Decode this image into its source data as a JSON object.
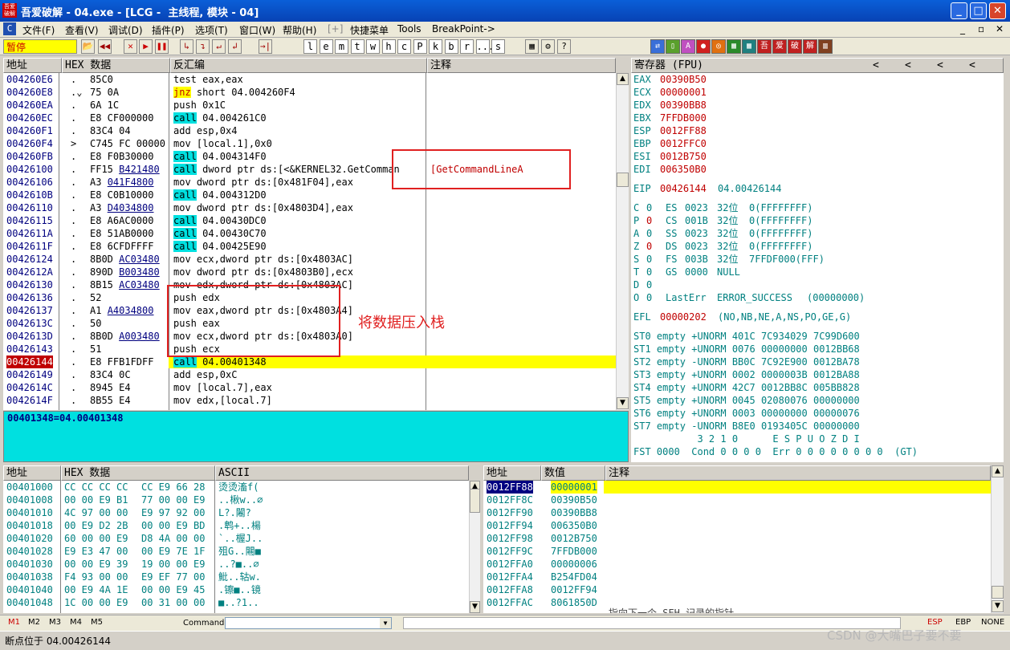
{
  "title": {
    "icon_text": "吾爱破解",
    "text": "吾爱破解 - 04.exe - [LCG -  主线程, 模块 - 04]",
    "min": "_",
    "max": "□",
    "close": "✕"
  },
  "menu": {
    "icon": "C",
    "items": [
      "文件(F)",
      "查看(V)",
      "调试(D)",
      "插件(P)",
      "选项(T)",
      "窗口(W)",
      "帮助(H)",
      "[+]",
      "快捷菜单",
      "Tools",
      "BreakPoint->"
    ],
    "child_btns": [
      "_",
      "▫",
      "✕"
    ]
  },
  "toolbar": {
    "state": "暂停",
    "buttons": [
      "📂",
      "◀◀",
      "✕",
      "▶",
      "❚❚",
      "↳",
      "↴",
      "↵",
      "↲",
      "→|"
    ],
    "letters": [
      "l",
      "e",
      "m",
      "t",
      "w",
      "h",
      "c",
      "P",
      "k",
      "b",
      "r",
      "...",
      "s"
    ],
    "icons": [
      "▦",
      "⚙",
      "?"
    ],
    "right_icons": [
      "⇄",
      "▯",
      "A",
      "●",
      "◎",
      "▦",
      "▦",
      "吾",
      "爱",
      "破",
      "解",
      "▥"
    ],
    "right_colors": [
      "#3a6fd8",
      "#5aa02c",
      "#c050c0",
      "#d02020",
      "#e07010",
      "#2a8a2a",
      "#208080",
      "#c02020",
      "#c02020",
      "#c02020",
      "#c02020",
      "#804020"
    ]
  },
  "disasm": {
    "headers": {
      "addr": "地址",
      "hex": "HEX 数据",
      "asm": "反汇编",
      "comment": "注释"
    },
    "rows": [
      {
        "addr": "004260E6",
        "mark": ".",
        "hex": "85C0",
        "hexu": "",
        "asm": "test eax,eax",
        "kw": "",
        "cmt": ""
      },
      {
        "addr": "004260E8",
        "mark": ".⌄",
        "hex": "75 0A",
        "hexu": "",
        "asm": "jnz short 04.004260F4",
        "kw": "jnz",
        "cmt": ""
      },
      {
        "addr": "004260EA",
        "mark": ".",
        "hex": "6A 1C",
        "hexu": "",
        "asm": "push 0x1C",
        "kw": "",
        "cmt": ""
      },
      {
        "addr": "004260EC",
        "mark": ".",
        "hex": "E8 CF000000",
        "hexu": "",
        "asm": "call 04.004261C0",
        "kw": "call",
        "cmt": ""
      },
      {
        "addr": "004260F1",
        "mark": ".",
        "hex": "83C4 04",
        "hexu": "",
        "asm": "add esp,0x4",
        "kw": "",
        "cmt": ""
      },
      {
        "addr": "004260F4",
        "mark": ">",
        "hex": "C745 FC 00000",
        "hexu": "",
        "asm": "mov [local.1],0x0",
        "kw": "",
        "cmt": ""
      },
      {
        "addr": "004260FB",
        "mark": ".",
        "hex": "E8 F0B30000",
        "hexu": "",
        "asm": "call 04.004314F0",
        "kw": "call",
        "cmt": ""
      },
      {
        "addr": "00426100",
        "mark": ".",
        "hex": "FF15 ",
        "hexu": "B421480",
        "asm": "call dword ptr ds:[<&KERNEL32.GetComman",
        "kw": "call",
        "cmt": "[GetCommandLineA"
      },
      {
        "addr": "00426106",
        "mark": ".",
        "hex": "A3 ",
        "hexu": "041F4800",
        "asm": "mov dword ptr ds:[0x481F04],eax",
        "kw": "",
        "cmt": ""
      },
      {
        "addr": "0042610B",
        "mark": ".",
        "hex": "E8 C0B10000",
        "hexu": "",
        "asm": "call 04.004312D0",
        "kw": "call",
        "cmt": ""
      },
      {
        "addr": "00426110",
        "mark": ".",
        "hex": "A3 ",
        "hexu": "D4034800",
        "asm": "mov dword ptr ds:[0x4803D4],eax",
        "kw": "",
        "cmt": ""
      },
      {
        "addr": "00426115",
        "mark": ".",
        "hex": "E8 A6AC0000",
        "hexu": "",
        "asm": "call 04.00430DC0",
        "kw": "call",
        "cmt": ""
      },
      {
        "addr": "0042611A",
        "mark": ".",
        "hex": "E8 51AB0000",
        "hexu": "",
        "asm": "call 04.00430C70",
        "kw": "call",
        "cmt": ""
      },
      {
        "addr": "0042611F",
        "mark": ".",
        "hex": "E8 6CFDFFFF",
        "hexu": "",
        "asm": "call 04.00425E90",
        "kw": "call",
        "cmt": ""
      },
      {
        "addr": "00426124",
        "mark": ".",
        "hex": "8B0D ",
        "hexu": "AC03480",
        "asm": "mov ecx,dword ptr ds:[0x4803AC]",
        "kw": "",
        "cmt": ""
      },
      {
        "addr": "0042612A",
        "mark": ".",
        "hex": "890D ",
        "hexu": "B003480",
        "asm": "mov dword ptr ds:[0x4803B0],ecx",
        "kw": "",
        "cmt": ""
      },
      {
        "addr": "00426130",
        "mark": ".",
        "hex": "8B15 ",
        "hexu": "AC03480",
        "asm": "mov edx,dword ptr ds:[0x4803AC]",
        "kw": "",
        "cmt": ""
      },
      {
        "addr": "00426136",
        "mark": ".",
        "hex": "52",
        "hexu": "",
        "asm": "push edx",
        "kw": "",
        "cmt": ""
      },
      {
        "addr": "00426137",
        "mark": ".",
        "hex": "A1 ",
        "hexu": "A4034800",
        "asm": "mov eax,dword ptr ds:[0x4803A4]",
        "kw": "",
        "cmt": ""
      },
      {
        "addr": "0042613C",
        "mark": ".",
        "hex": "50",
        "hexu": "",
        "asm": "push eax",
        "kw": "",
        "cmt": ""
      },
      {
        "addr": "0042613D",
        "mark": ".",
        "hex": "8B0D ",
        "hexu": "A003480",
        "asm": "mov ecx,dword ptr ds:[0x4803A0]",
        "kw": "",
        "cmt": ""
      },
      {
        "addr": "00426143",
        "mark": ".",
        "hex": "51",
        "hexu": "",
        "asm": "push ecx",
        "kw": "",
        "cmt": ""
      },
      {
        "addr": "00426144",
        "mark": ".",
        "hex": "E8 FFB1FDFF",
        "hexu": "",
        "asm": "call 04.00401348",
        "kw": "call",
        "cmt": "",
        "current": true
      },
      {
        "addr": "00426149",
        "mark": ".",
        "hex": "83C4 0C",
        "hexu": "",
        "asm": "add esp,0xC",
        "kw": "",
        "cmt": ""
      },
      {
        "addr": "0042614C",
        "mark": ".",
        "hex": "8945 E4",
        "hexu": "",
        "asm": "mov [local.7],eax",
        "kw": "",
        "cmt": ""
      },
      {
        "addr": "0042614F",
        "mark": ".",
        "hex": "8B55 E4",
        "hexu": "",
        "asm": "mov edx,[local.7]",
        "kw": "",
        "cmt": ""
      }
    ],
    "info": "00401348=04.00401348",
    "annotation": "将数据压入栈"
  },
  "registers": {
    "header": "寄存器 (FPU)",
    "arrows": [
      "<",
      "<",
      "<",
      "<"
    ],
    "gp": [
      [
        "EAX",
        "00390B50"
      ],
      [
        "ECX",
        "00000001"
      ],
      [
        "EDX",
        "00390BB8"
      ],
      [
        "EBX",
        "7FFDB000"
      ],
      [
        "ESP",
        "0012FF88"
      ],
      [
        "EBP",
        "0012FFC0"
      ],
      [
        "ESI",
        "0012B750"
      ],
      [
        "EDI",
        "006350B0"
      ]
    ],
    "eip": {
      "name": "EIP",
      "value": "00426144",
      "label": "04.00426144"
    },
    "flags": [
      [
        "C",
        "0",
        "ES",
        "0023",
        "32位",
        "0(FFFFFFFF)"
      ],
      [
        "P",
        "0",
        "CS",
        "001B",
        "32位",
        "0(FFFFFFFF)"
      ],
      [
        "A",
        "0",
        "SS",
        "0023",
        "32位",
        "0(FFFFFFFF)"
      ],
      [
        "Z",
        "0",
        "DS",
        "0023",
        "32位",
        "0(FFFFFFFF)"
      ],
      [
        "S",
        "0",
        "FS",
        "003B",
        "32位",
        "7FFDF000(FFF)"
      ],
      [
        "T",
        "0",
        "GS",
        "0000",
        "NULL",
        ""
      ],
      [
        "D",
        "0",
        "",
        "",
        "",
        ""
      ],
      [
        "O",
        "0",
        "LastErr",
        "ERROR_SUCCESS",
        "(00000000)",
        ""
      ]
    ],
    "efl": {
      "name": "EFL",
      "value": "00000202",
      "desc": "(NO,NB,NE,A,NS,PO,GE,G)"
    },
    "fpu": [
      "ST0 empty +UNORM 401C 7C934029 7C99D600",
      "ST1 empty +UNORM 0076 00000000 0012BB68",
      "ST2 empty -UNORM BB0C 7C92E900 0012BA78",
      "ST3 empty +UNORM 0002 0000003B 0012BA88",
      "ST4 empty +UNORM 42C7 0012BB8C 005BB828",
      "ST5 empty +UNORM 0045 02080076 00000000",
      "ST6 empty +UNORM 0003 00000000 00000076",
      "ST7 empty -UNORM B8E0 0193405C 00000000"
    ],
    "fpu_bits": "           3 2 1 0      E S P U O Z D I",
    "fst": "FST 0000  Cond 0 0 0 0  Err 0 0 0 0 0 0 0 0  (GT)"
  },
  "dump": {
    "headers": {
      "addr": "地址",
      "hex": "HEX 数据",
      "ascii": "ASCII"
    },
    "rows": [
      [
        "00401000",
        "CC CC CC CC",
        "CC E9 66 28",
        "烫烫滀f("
      ],
      [
        "00401008",
        "00 00 E9 B1",
        "77 00 00 E9",
        "..楸w..∅"
      ],
      [
        "00401010",
        "4C 97 00 00",
        "E9 97 92 00",
        "L?.闂?"
      ],
      [
        "00401018",
        "00 E9 D2 2B",
        "00 00 E9 BD",
        ".鹎+..楊"
      ],
      [
        "00401020",
        "60 00 00 E9",
        "D8 4A 00 00",
        "`..楃J.."
      ],
      [
        "00401028",
        "E9 E3 47 00",
        "00 E9 7E 1F",
        "殂G..闀■"
      ],
      [
        "00401030",
        "00 00 E9 39",
        "19 00 00 E9",
        "..?■..∅"
      ],
      [
        "00401038",
        "F4 93 00 00",
        "E9 EF 77 00",
        "魮..轱w."
      ],
      [
        "00401040",
        "00 E9 4A 1E",
        "00 00 E9 45",
        ".镲■..镜"
      ],
      [
        "00401048",
        "1C 00 00 E9",
        "00 31 00 00",
        "■..?1.."
      ]
    ]
  },
  "stack": {
    "headers": {
      "addr": "地址",
      "value": "数值",
      "comment": "注释"
    },
    "rows": [
      [
        "0012FF88",
        "00000001"
      ],
      [
        "0012FF8C",
        "00390B50"
      ],
      [
        "0012FF90",
        "00390BB8"
      ],
      [
        "0012FF94",
        "006350B0"
      ],
      [
        "0012FF98",
        "0012B750"
      ],
      [
        "0012FF9C",
        "7FFDB000"
      ],
      [
        "0012FFA0",
        "00000006"
      ],
      [
        "0012FFA4",
        "B254FD04"
      ],
      [
        "0012FFA8",
        "0012FF94"
      ],
      [
        "0012FFAC",
        "8061850D"
      ]
    ],
    "partial_comment": "指向下一个 SEH 记录的指针"
  },
  "command": {
    "tabs": [
      "M1",
      "M2",
      "M3",
      "M4",
      "M5"
    ],
    "label": "Command:",
    "regs": [
      "ESP",
      "EBP",
      "NONE"
    ]
  },
  "status": {
    "text": "断点位于 04.00426144",
    "watermark": "CSDN @大嘴巴子要不要"
  }
}
